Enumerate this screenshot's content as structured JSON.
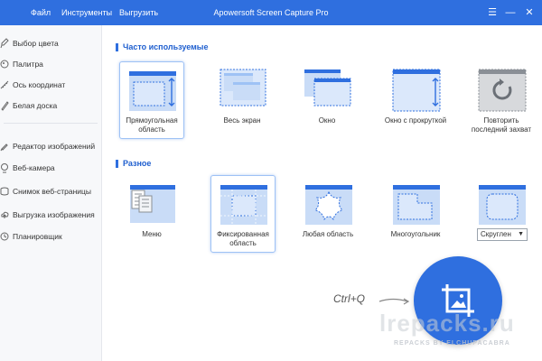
{
  "colors": {
    "accent": "#2f6fdf",
    "sidebar_bg": "#f7f8fa",
    "tile_light": "#c9dcf7"
  },
  "titlebar": {
    "menu": [
      "Файл",
      "Инструменты",
      "Выгрузить"
    ],
    "title": "Apowersoft Screen Capture Pro",
    "window_buttons": [
      "menu-icon",
      "minimize-icon",
      "close-icon"
    ]
  },
  "sidebar": {
    "items": [
      {
        "label": "Выбор цвета",
        "icon": "eyedropper-icon"
      },
      {
        "label": "Палитра",
        "icon": "palette-icon"
      },
      {
        "label": "Ось координат",
        "icon": "ruler-icon"
      },
      {
        "label": "Белая доска",
        "icon": "whiteboard-icon"
      },
      {
        "label": "Редактор изображений",
        "icon": "image-editor-icon"
      },
      {
        "label": "Веб-камера",
        "icon": "webcam-icon"
      },
      {
        "label": "Снимок веб-страницы",
        "icon": "webpage-icon"
      },
      {
        "label": "Выгрузка изображения",
        "icon": "upload-icon"
      },
      {
        "label": "Планировщик",
        "icon": "scheduler-icon"
      }
    ]
  },
  "sections": {
    "frequent": {
      "title": "Часто используемые",
      "tiles": [
        "Прямоугольная область",
        "Весь экран",
        "Окно",
        "Окно с прокруткой",
        "Повторить последний захват"
      ]
    },
    "misc": {
      "title": "Разное",
      "tiles": [
        "Меню",
        "Фиксированная область",
        "Любая область",
        "Многоугольник"
      ],
      "shape_select": "Скруглен"
    }
  },
  "capture": {
    "shortcut": "Ctrl+Q"
  },
  "watermark": {
    "main": "lrepacks.ru",
    "sub": "REPACKS BY ELCHUPACABRA"
  }
}
